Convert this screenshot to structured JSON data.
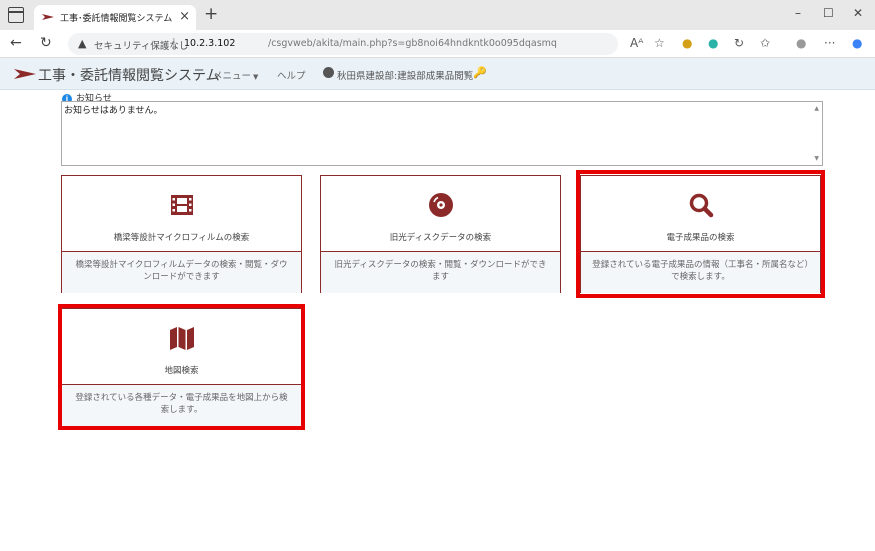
{
  "browser": {
    "tab_title": "工事･委託情報閲覧システム",
    "url_security": "セキュリティ保護なし",
    "url_host": "10.2.3.102",
    "url_path": "/csgvweb/akita/main.php?s=gb8noi64hndkntk0o095dqasmq"
  },
  "navbar": {
    "brand": "工事・委託情報閲覧システム",
    "menu": "メニュー",
    "help": "ヘルプ",
    "user": "秋田県建設部:建設部成果品閲覧"
  },
  "notice": {
    "label": "お知らせ",
    "text": "お知らせはありません。"
  },
  "cards": [
    {
      "title": "橋梁等設計マイクロフィルムの検索",
      "description": "橋梁等設計マイクロフィルムデータの検索・閲覧・ダウンロードができます",
      "icon": "film-icon"
    },
    {
      "title": "旧光ディスクデータの検索",
      "description": "旧光ディスクデータの検索・閲覧・ダウンロードができます",
      "icon": "disc-icon"
    },
    {
      "title": "電子成果品の検索",
      "description": "登録されている電子成果品の情報（工事名・所属名など）で検索します。",
      "icon": "search-icon"
    },
    {
      "title": "地図検索",
      "description": "登録されている各種データ・電子成果品を地図上から検索します。",
      "icon": "map-icon"
    }
  ],
  "colors": {
    "accent": "#8c2a2a",
    "highlight": "#e60000",
    "navbar_bg": "#eaf2f8"
  }
}
